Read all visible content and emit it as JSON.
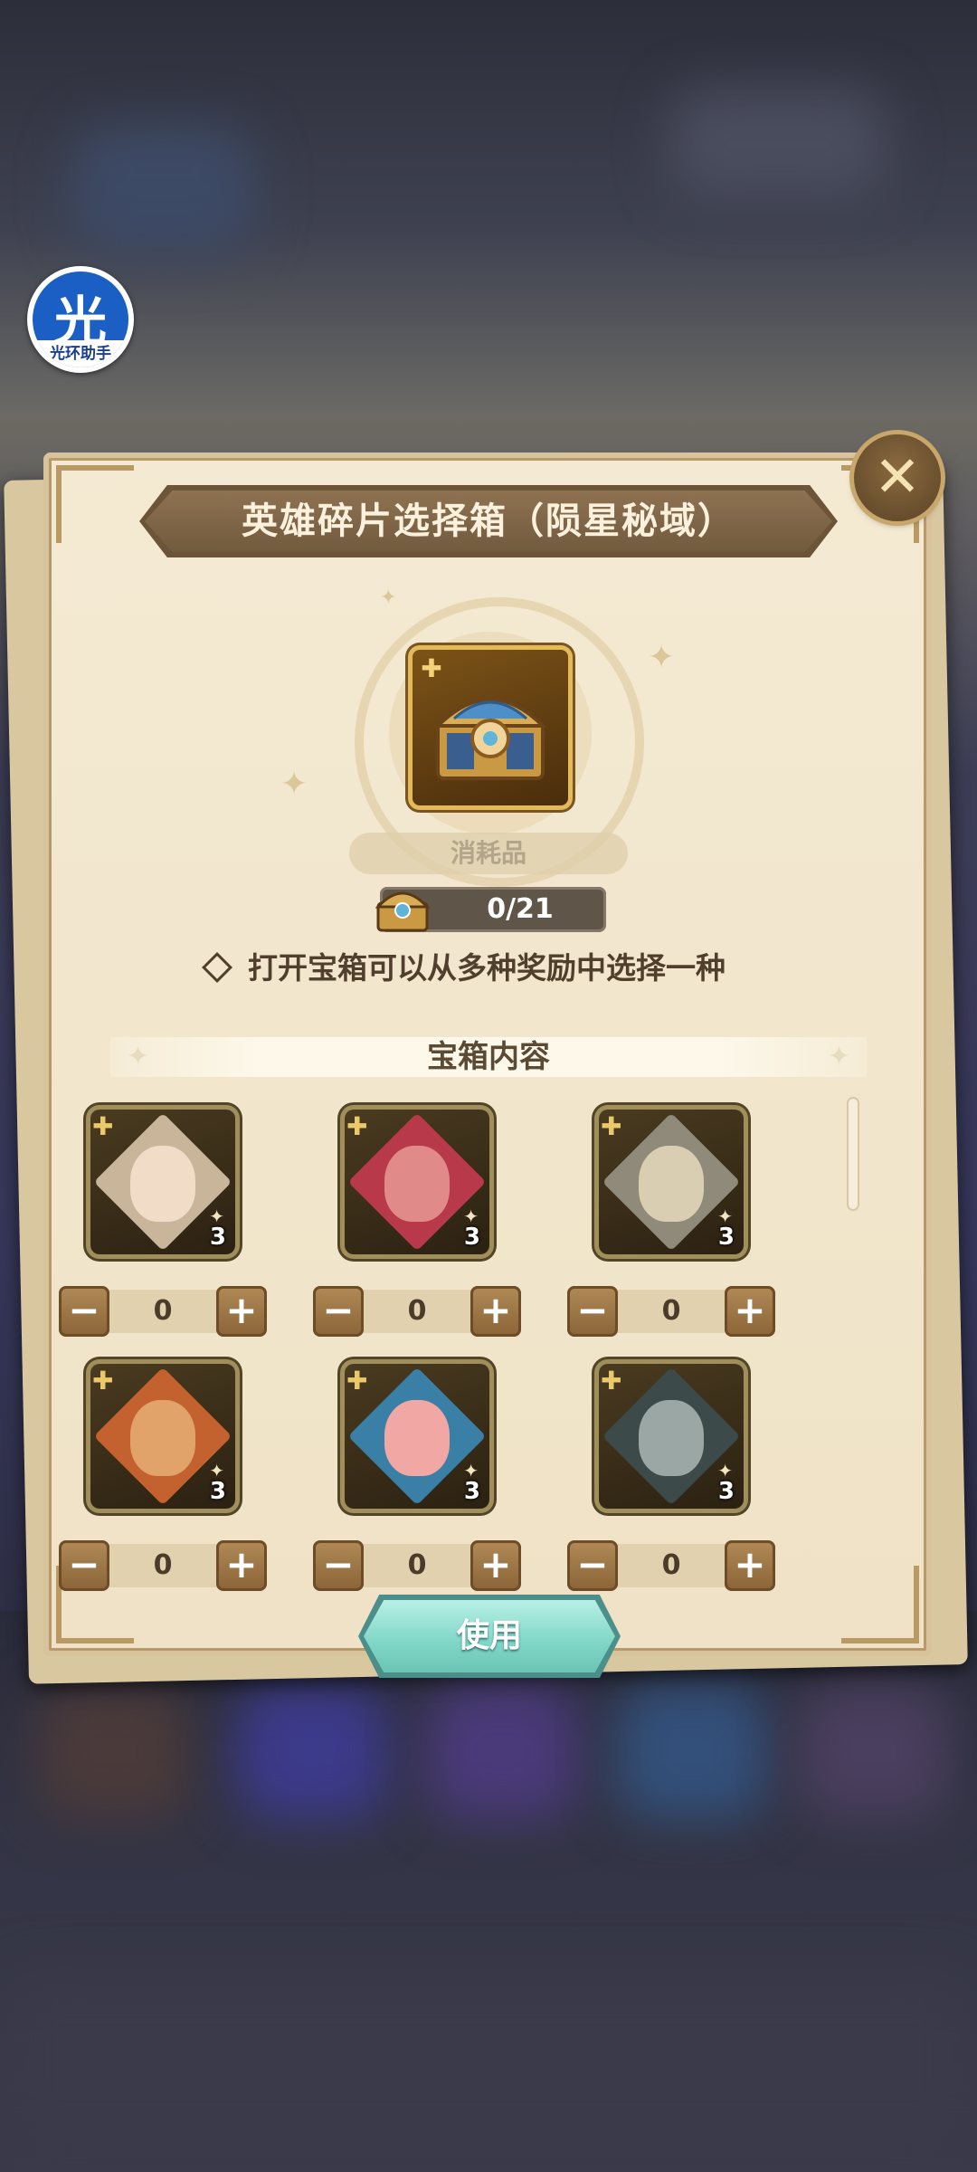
{
  "helper_badge": {
    "glyph": "光",
    "caption": "光环助手"
  },
  "dialog": {
    "title": "英雄碎片选择箱（陨星秘域）",
    "close_icon": "close-icon",
    "item": {
      "icon": "treasure-chest-icon",
      "type_label": "消耗品"
    },
    "owned_count": "0/21",
    "description": "打开宝箱可以从多种奖励中选择一种",
    "section_title": "宝箱内容",
    "heroes": [
      {
        "shard_count": "3",
        "value": "0",
        "accent": "#c9b59a",
        "skin": "#f1dcc8"
      },
      {
        "shard_count": "3",
        "value": "0",
        "accent": "#b83a4a",
        "skin": "#e08a8a"
      },
      {
        "shard_count": "3",
        "value": "0",
        "accent": "#8f8a7a",
        "skin": "#d9cdb2"
      },
      {
        "shard_count": "3",
        "value": "0",
        "accent": "#c4622f",
        "skin": "#e2a36b"
      },
      {
        "shard_count": "3",
        "value": "0",
        "accent": "#3a7fa6",
        "skin": "#f1a7a4"
      },
      {
        "shard_count": "3",
        "value": "0",
        "accent": "#3c4a4a",
        "skin": "#9aa7a5"
      }
    ],
    "use_button": "使用"
  }
}
